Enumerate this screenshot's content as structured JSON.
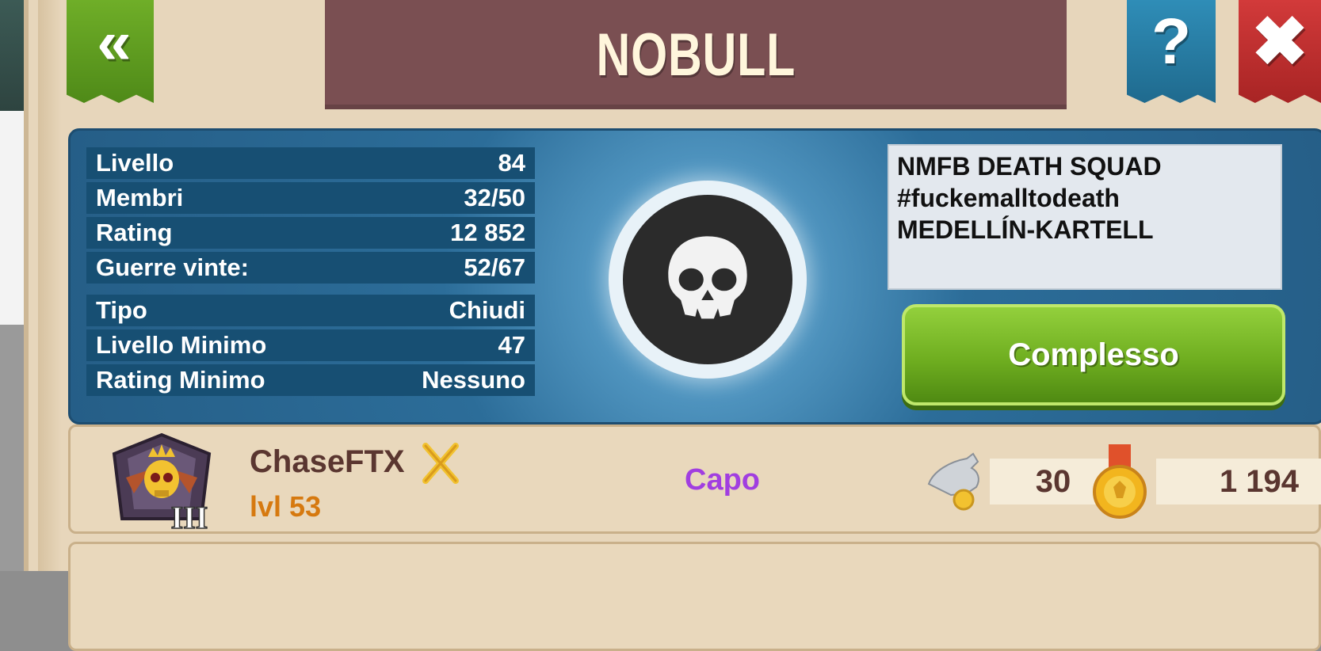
{
  "header": {
    "title": "NOBULL",
    "back_icon": "«",
    "help_icon": "?",
    "close_icon": "✖"
  },
  "clan_stats": {
    "rows_top": [
      {
        "label": "Livello",
        "value": "84"
      },
      {
        "label": "Membri",
        "value": "32/50"
      },
      {
        "label": "Rating",
        "value": "12 852"
      },
      {
        "label": "Guerre vinte:",
        "value": "52/67"
      }
    ],
    "rows_bottom": [
      {
        "label": "Tipo",
        "value": "Chiudi"
      },
      {
        "label": "Livello Minimo",
        "value": "47"
      },
      {
        "label": "Rating Minimo",
        "value": "Nessuno"
      }
    ]
  },
  "emblem": {
    "icon": "skull-icon"
  },
  "motto": "NMFB DEATH SQUAD\n#fuckemalltodeath\nMEDELLÍN-KARTELL",
  "complex_button_label": "Complesso",
  "members": [
    {
      "name": "ChaseFTX",
      "level_prefix": "lvl",
      "level": "53",
      "role": "Capo",
      "stat1": "30",
      "stat2": "1 194",
      "rank_numeral": "III"
    }
  ],
  "colors": {
    "panel_blue": "#2c6d99",
    "button_green": "#6fae20",
    "role_purple": "#a13ee0",
    "level_orange": "#d6790f"
  }
}
